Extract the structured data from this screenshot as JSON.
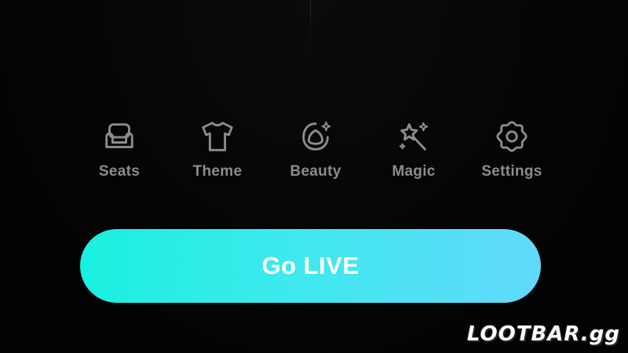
{
  "toolbar": {
    "items": [
      {
        "label": "Seats",
        "icon": "seat-icon"
      },
      {
        "label": "Theme",
        "icon": "tshirt-icon"
      },
      {
        "label": "Beauty",
        "icon": "beauty-icon"
      },
      {
        "label": "Magic",
        "icon": "magic-wand-icon"
      },
      {
        "label": "Settings",
        "icon": "gear-icon"
      }
    ]
  },
  "go_live": {
    "label": "Go LIVE"
  },
  "watermark": {
    "text": "LOOTBAR.gg"
  },
  "colors": {
    "background": "#050505",
    "icon_stroke": "#8c8c8c",
    "button_gradient_start": "#19f0df",
    "button_gradient_end": "#62d9fb"
  }
}
